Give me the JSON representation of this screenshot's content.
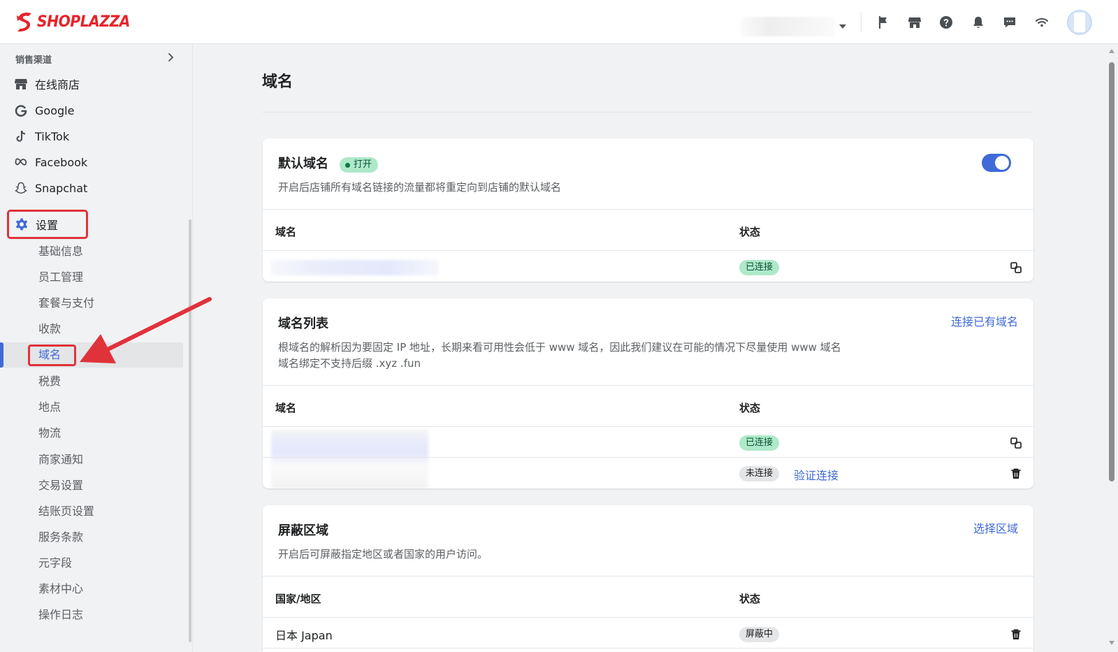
{
  "header": {
    "brand": "SHOPLAZZA",
    "brand_color": "#e5242b",
    "icons": [
      "flag-icon",
      "store-icon",
      "help-icon",
      "bell-icon",
      "chat-icon",
      "wifi-icon"
    ]
  },
  "sidebar": {
    "section_title": "销售渠道",
    "channels": [
      {
        "label": "在线商店",
        "icon": "store-icon"
      },
      {
        "label": "Google",
        "icon": "google-icon"
      },
      {
        "label": "TikTok",
        "icon": "tiktok-icon"
      },
      {
        "label": "Facebook",
        "icon": "meta-icon"
      },
      {
        "label": "Snapchat",
        "icon": "snapchat-icon"
      }
    ],
    "settings_label": "设置",
    "settings_items": [
      "基础信息",
      "员工管理",
      "套餐与支付",
      "收款",
      "域名",
      "税费",
      "地点",
      "物流",
      "商家通知",
      "交易设置",
      "结账页设置",
      "服务条款",
      "元字段",
      "素材中心",
      "操作日志"
    ],
    "active_item": "域名"
  },
  "main": {
    "title": "域名",
    "default_domain": {
      "title": "默认域名",
      "status_badge": "打开",
      "toggle_on": true,
      "description": "开启后店铺所有域名链接的流量都将重定向到店铺的默认域名",
      "col_domain": "域名",
      "col_status": "状态",
      "rows": [
        {
          "status": "已连接"
        }
      ]
    },
    "domain_list": {
      "title": "域名列表",
      "action": "连接已有域名",
      "desc_line1": "根域名的解析因为要固定 IP 地址，长期来看可用性会低于 www 域名，因此我们建议在可能的情况下尽量使用 www 域名",
      "desc_line2": "域名绑定不支持后缀 .xyz .fun",
      "col_domain": "域名",
      "col_status": "状态",
      "rows": [
        {
          "status": "已连接"
        },
        {
          "status": "未连接",
          "action": "验证连接"
        }
      ]
    },
    "blocked_regions": {
      "title": "屏蔽区域",
      "action": "选择区域",
      "description": "开启后可屏蔽指定地区或者国家的用户访问。",
      "col_region": "国家/地区",
      "col_status": "状态",
      "rows": [
        {
          "region": "日本 Japan",
          "status": "屏蔽中"
        }
      ]
    }
  },
  "colors": {
    "accent": "#3f6ad8",
    "success_badge": "#aee9c9",
    "neutral_badge": "#e4e5e7",
    "highlight": "#e0323a"
  }
}
